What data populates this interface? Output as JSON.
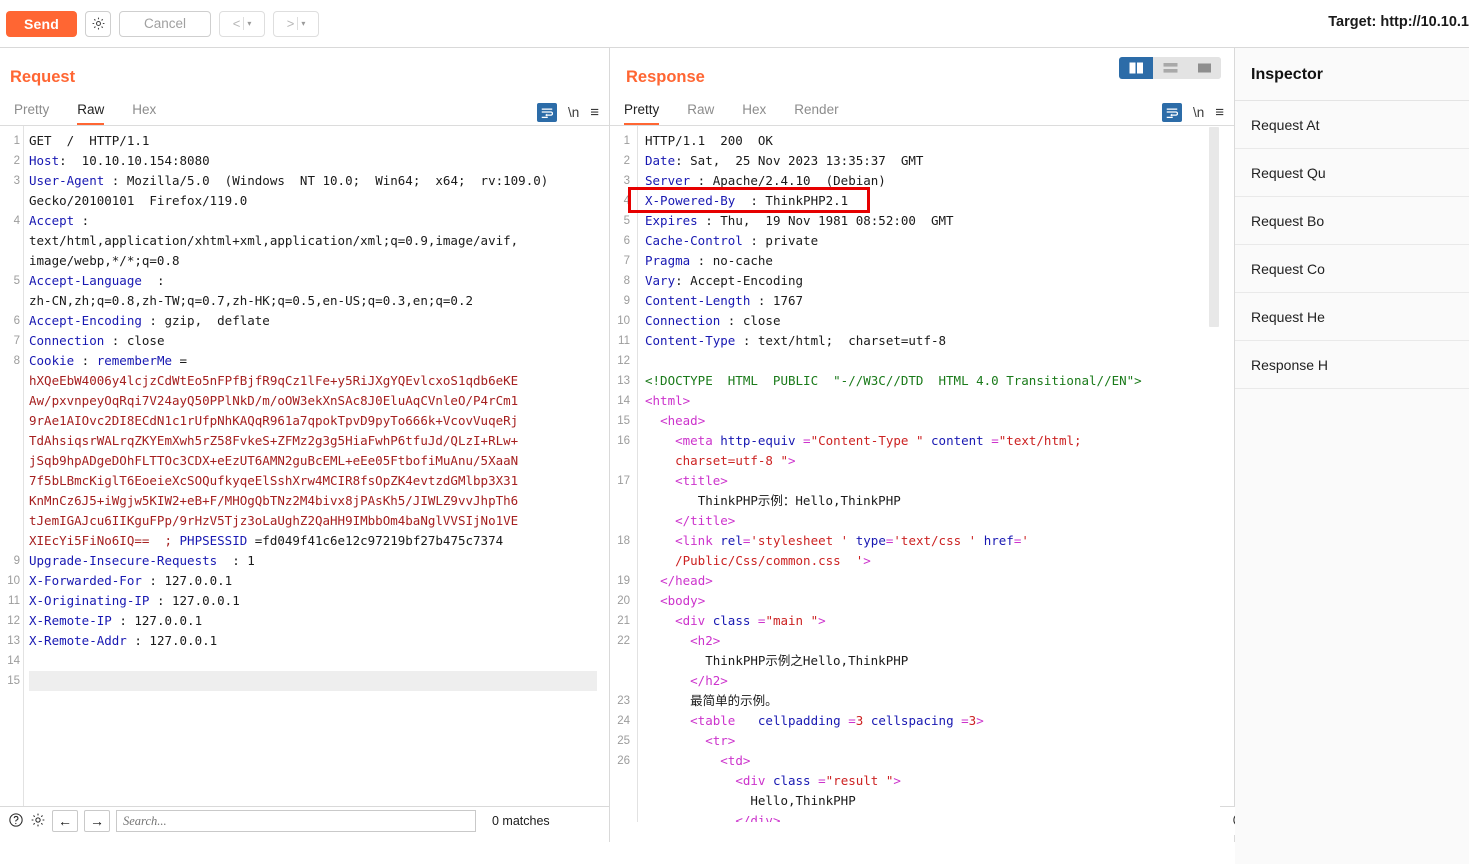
{
  "toolbar": {
    "send_label": "Send",
    "settings_icon": "gear-icon",
    "cancel_label": "Cancel",
    "back_label": "<",
    "forward_label": ">",
    "caret": "▾",
    "target_label": "Target: http://10.10.1"
  },
  "request": {
    "title": "Request",
    "tabs": [
      {
        "label": "Pretty",
        "active": false
      },
      {
        "label": "Raw",
        "active": true
      },
      {
        "label": "Hex",
        "active": false
      }
    ],
    "newline_label": "\\n",
    "lines": [
      {
        "n": "1",
        "parts": [
          {
            "t": "GET  /  HTTP/1.1",
            "c": "k-plain"
          }
        ]
      },
      {
        "n": "2",
        "parts": [
          {
            "t": "Host",
            "c": "k-blue"
          },
          {
            "t": ":  10.10.10.154:8080",
            "c": "k-plain"
          }
        ]
      },
      {
        "n": "3",
        "parts": [
          {
            "t": "User-Agent",
            "c": "k-blue"
          },
          {
            "t": " : Mozilla/5.0  (Windows  NT 10.0;  Win64;  x64;  rv:109.0)",
            "c": "k-plain"
          }
        ]
      },
      {
        "n": "",
        "parts": [
          {
            "t": "Gecko/20100101  Firefox/119.0",
            "c": "k-plain"
          }
        ]
      },
      {
        "n": "4",
        "parts": [
          {
            "t": "Accept",
            "c": "k-blue"
          },
          {
            "t": " :",
            "c": "k-plain"
          }
        ]
      },
      {
        "n": "",
        "parts": [
          {
            "t": "text/html,application/xhtml+xml,application/xml;q=0.9,image/avif,",
            "c": "k-plain"
          }
        ]
      },
      {
        "n": "",
        "parts": [
          {
            "t": "image/webp,*/*;q=0.8",
            "c": "k-plain"
          }
        ]
      },
      {
        "n": "5",
        "parts": [
          {
            "t": "Accept-Language",
            "c": "k-blue"
          },
          {
            "t": "  :",
            "c": "k-plain"
          }
        ]
      },
      {
        "n": "",
        "parts": [
          {
            "t": "zh-CN,zh;q=0.8,zh-TW;q=0.7,zh-HK;q=0.5,en-US;q=0.3,en;q=0.2",
            "c": "k-plain"
          }
        ]
      },
      {
        "n": "6",
        "parts": [
          {
            "t": "Accept-Encoding",
            "c": "k-blue"
          },
          {
            "t": " : gzip,  deflate",
            "c": "k-plain"
          }
        ]
      },
      {
        "n": "7",
        "parts": [
          {
            "t": "Connection",
            "c": "k-blue"
          },
          {
            "t": " : close",
            "c": "k-plain"
          }
        ]
      },
      {
        "n": "8",
        "parts": [
          {
            "t": "Cookie",
            "c": "k-blue"
          },
          {
            "t": " : ",
            "c": "k-plain"
          },
          {
            "t": "rememberMe",
            "c": "k-blue"
          },
          {
            "t": " =",
            "c": "k-plain"
          }
        ]
      },
      {
        "n": "",
        "parts": [
          {
            "t": "hXQeEbW4006y4lcjzCdWtEo5nFPfBjfR9qCz1lFe+y5RiJXgYQEvlcxoS1qdb6eKE",
            "c": "k-cookie"
          }
        ]
      },
      {
        "n": "",
        "parts": [
          {
            "t": "Aw/pxvnpeyOqRqi7V24ayQ50PPlNkD/m/oOW3ekXnSAc8J0EluAqCVnleO/P4rCm1",
            "c": "k-cookie"
          }
        ]
      },
      {
        "n": "",
        "parts": [
          {
            "t": "9rAe1AIOvc2DI8ECdN1c1rUfpNhKAQqR961a7qpokTpvD9pyTo666k+VcovVuqeRj",
            "c": "k-cookie"
          }
        ]
      },
      {
        "n": "",
        "parts": [
          {
            "t": "TdAhsiqsrWALrqZKYEmXwh5rZ58FvkeS+ZFMz2g3g5HiaFwhP6tfuJd/QLzI+RLw+",
            "c": "k-cookie"
          }
        ]
      },
      {
        "n": "",
        "parts": [
          {
            "t": "jSqb9hpADgeDOhFLTTOc3CDX+eEzUT6AMN2guBcEML+eEe05FtbofiMuAnu/5XaaN",
            "c": "k-cookie"
          }
        ]
      },
      {
        "n": "",
        "parts": [
          {
            "t": "7f5bLBmcKiglT6EoeieXcSOQufkyqeElSshXrw4MCIR8fsOpZK4evtzdGMlbp3X31",
            "c": "k-cookie"
          }
        ]
      },
      {
        "n": "",
        "parts": [
          {
            "t": "KnMnCz6J5+iWgjw5KIW2+eB+F/MHOgQbTNz2M4bivx8jPAsKh5/JIWLZ9vvJhpTh6",
            "c": "k-cookie"
          }
        ]
      },
      {
        "n": "",
        "parts": [
          {
            "t": "tJemIGAJcu6IIKguFPp/9rHzV5Tjz3oLaUghZ2QaHH9IMbbOm4baNglVVSIjNo1VE",
            "c": "k-cookie"
          }
        ]
      },
      {
        "n": "",
        "parts": [
          {
            "t": "XIEcYi5FiNo6IQ==  ; ",
            "c": "k-cookie"
          },
          {
            "t": "PHPSESSID",
            "c": "k-blue"
          },
          {
            "t": " =fd049f41c6e12c97219bf27b475c7374",
            "c": "k-plain"
          }
        ]
      },
      {
        "n": "9",
        "parts": [
          {
            "t": "Upgrade-Insecure-Requests",
            "c": "k-blue"
          },
          {
            "t": "  : 1",
            "c": "k-plain"
          }
        ]
      },
      {
        "n": "10",
        "parts": [
          {
            "t": "X-Forwarded-For",
            "c": "k-blue"
          },
          {
            "t": " : 127.0.0.1",
            "c": "k-plain"
          }
        ]
      },
      {
        "n": "11",
        "parts": [
          {
            "t": "X-Originating-IP",
            "c": "k-blue"
          },
          {
            "t": " : 127.0.0.1",
            "c": "k-plain"
          }
        ]
      },
      {
        "n": "12",
        "parts": [
          {
            "t": "X-Remote-IP",
            "c": "k-blue"
          },
          {
            "t": " : 127.0.0.1",
            "c": "k-plain"
          }
        ]
      },
      {
        "n": "13",
        "parts": [
          {
            "t": "X-Remote-Addr",
            "c": "k-blue"
          },
          {
            "t": " : 127.0.0.1",
            "c": "k-plain"
          }
        ]
      },
      {
        "n": "14",
        "parts": [
          {
            "t": "",
            "c": "k-plain"
          }
        ]
      },
      {
        "n": "15",
        "parts": [
          {
            "t": "",
            "c": "k-plain"
          }
        ],
        "highlight": true
      }
    ]
  },
  "response": {
    "title": "Response",
    "tabs": [
      {
        "label": "Pretty",
        "active": true
      },
      {
        "label": "Raw",
        "active": false
      },
      {
        "label": "Hex",
        "active": false
      },
      {
        "label": "Render",
        "active": false
      }
    ],
    "newline_label": "\\n",
    "layout_buttons": [
      {
        "name": "split-vertical",
        "active": true
      },
      {
        "name": "split-horizontal",
        "active": false
      },
      {
        "name": "single-pane",
        "active": false
      }
    ],
    "highlight_box": {
      "line": 4,
      "color": "#e60000"
    },
    "lines": [
      {
        "n": "1",
        "parts": [
          {
            "t": "HTTP/1.1  200  OK",
            "c": "k-plain"
          }
        ]
      },
      {
        "n": "2",
        "parts": [
          {
            "t": "Date",
            "c": "k-blue"
          },
          {
            "t": ": Sat,  25 Nov 2023 13:35:37  GMT",
            "c": "k-plain"
          }
        ]
      },
      {
        "n": "3",
        "parts": [
          {
            "t": "Server",
            "c": "k-blue"
          },
          {
            "t": " : Apache/2.4.10  (Debian)",
            "c": "k-plain"
          }
        ]
      },
      {
        "n": "4",
        "parts": [
          {
            "t": "X-Powered-By",
            "c": "k-blue"
          },
          {
            "t": "  : ThinkPHP2.1",
            "c": "k-plain"
          }
        ]
      },
      {
        "n": "5",
        "parts": [
          {
            "t": "Expires",
            "c": "k-blue"
          },
          {
            "t": " : Thu,  19 Nov 1981 08:52:00  GMT",
            "c": "k-plain"
          }
        ]
      },
      {
        "n": "6",
        "parts": [
          {
            "t": "Cache-Control",
            "c": "k-blue"
          },
          {
            "t": " : private",
            "c": "k-plain"
          }
        ]
      },
      {
        "n": "7",
        "parts": [
          {
            "t": "Pragma",
            "c": "k-blue"
          },
          {
            "t": " : no-cache",
            "c": "k-plain"
          }
        ]
      },
      {
        "n": "8",
        "parts": [
          {
            "t": "Vary",
            "c": "k-blue"
          },
          {
            "t": ": Accept-Encoding",
            "c": "k-plain"
          }
        ]
      },
      {
        "n": "9",
        "parts": [
          {
            "t": "Content-Length",
            "c": "k-blue"
          },
          {
            "t": " : 1767",
            "c": "k-plain"
          }
        ]
      },
      {
        "n": "10",
        "parts": [
          {
            "t": "Connection",
            "c": "k-blue"
          },
          {
            "t": " : close",
            "c": "k-plain"
          }
        ]
      },
      {
        "n": "11",
        "parts": [
          {
            "t": "Content-Type",
            "c": "k-blue"
          },
          {
            "t": " : text/html;  charset=utf-8",
            "c": "k-plain"
          }
        ]
      },
      {
        "n": "12",
        "parts": [
          {
            "t": "",
            "c": "k-plain"
          }
        ]
      },
      {
        "n": "13",
        "parts": [
          {
            "t": "<!DOCTYPE  HTML  PUBLIC  \"-//W3C//DTD  HTML 4.0 Transitional//EN\">",
            "c": "k-doctype"
          }
        ]
      },
      {
        "n": "14",
        "parts": [
          {
            "t": "<html",
            "c": "k-tag"
          },
          {
            "t": ">",
            "c": "k-tag"
          }
        ]
      },
      {
        "n": "15",
        "parts": [
          {
            "t": "  <head>",
            "c": "k-tag"
          }
        ]
      },
      {
        "n": "16",
        "parts": [
          {
            "t": "    <meta ",
            "c": "k-tag"
          },
          {
            "t": "http-equiv",
            "c": "k-attr"
          },
          {
            "t": " =",
            "c": "k-tag"
          },
          {
            "t": "\"Content-Type \"",
            "c": "k-val"
          },
          {
            "t": " ",
            "c": "k-tag"
          },
          {
            "t": "content",
            "c": "k-attr"
          },
          {
            "t": " =",
            "c": "k-tag"
          },
          {
            "t": "\"text/html;",
            "c": "k-val"
          }
        ]
      },
      {
        "n": "",
        "parts": [
          {
            "t": "    ",
            "c": "k-tag"
          },
          {
            "t": "charset=utf-8 \"",
            "c": "k-val"
          },
          {
            "t": ">",
            "c": "k-tag"
          }
        ]
      },
      {
        "n": "17",
        "parts": [
          {
            "t": "    <title>",
            "c": "k-tag"
          }
        ]
      },
      {
        "n": "",
        "parts": [
          {
            "t": "       ThinkPHP示例：Hello,ThinkPHP",
            "c": "k-txt"
          }
        ]
      },
      {
        "n": "",
        "parts": [
          {
            "t": "    </title>",
            "c": "k-tag"
          }
        ]
      },
      {
        "n": "18",
        "parts": [
          {
            "t": "    <link ",
            "c": "k-tag"
          },
          {
            "t": "rel",
            "c": "k-attr"
          },
          {
            "t": "=",
            "c": "k-tag"
          },
          {
            "t": "'stylesheet '",
            "c": "k-val"
          },
          {
            "t": " ",
            "c": "k-tag"
          },
          {
            "t": "type",
            "c": "k-attr"
          },
          {
            "t": "=",
            "c": "k-tag"
          },
          {
            "t": "'text/css '",
            "c": "k-val"
          },
          {
            "t": " ",
            "c": "k-tag"
          },
          {
            "t": "href",
            "c": "k-attr"
          },
          {
            "t": "=",
            "c": "k-tag"
          },
          {
            "t": "'",
            "c": "k-val"
          }
        ]
      },
      {
        "n": "",
        "parts": [
          {
            "t": "    ",
            "c": "k-tag"
          },
          {
            "t": "/Public/Css/common.css  '",
            "c": "k-val"
          },
          {
            "t": ">",
            "c": "k-tag"
          }
        ]
      },
      {
        "n": "19",
        "parts": [
          {
            "t": "  </head>",
            "c": "k-tag"
          }
        ]
      },
      {
        "n": "20",
        "parts": [
          {
            "t": "  <body>",
            "c": "k-tag"
          }
        ]
      },
      {
        "n": "21",
        "parts": [
          {
            "t": "    <div ",
            "c": "k-tag"
          },
          {
            "t": "class",
            "c": "k-attr"
          },
          {
            "t": " =",
            "c": "k-tag"
          },
          {
            "t": "\"main \"",
            "c": "k-val"
          },
          {
            "t": ">",
            "c": "k-tag"
          }
        ]
      },
      {
        "n": "22",
        "parts": [
          {
            "t": "      <h2>",
            "c": "k-tag"
          }
        ]
      },
      {
        "n": "",
        "parts": [
          {
            "t": "        ThinkPHP示例之Hello,ThinkPHP",
            "c": "k-txt"
          }
        ]
      },
      {
        "n": "",
        "parts": [
          {
            "t": "      </h2>",
            "c": "k-tag"
          }
        ]
      },
      {
        "n": "23",
        "parts": [
          {
            "t": "      最简单的示例。",
            "c": "k-txt"
          }
        ]
      },
      {
        "n": "24",
        "parts": [
          {
            "t": "      <table ",
            "c": "k-tag"
          },
          {
            "t": "  cellpadding",
            "c": "k-attr"
          },
          {
            "t": " =",
            "c": "k-tag"
          },
          {
            "t": "3",
            "c": "k-val"
          },
          {
            "t": " ",
            "c": "k-tag"
          },
          {
            "t": "cellspacing",
            "c": "k-attr"
          },
          {
            "t": " =",
            "c": "k-tag"
          },
          {
            "t": "3",
            "c": "k-val"
          },
          {
            "t": ">",
            "c": "k-tag"
          }
        ]
      },
      {
        "n": "25",
        "parts": [
          {
            "t": "        <tr>",
            "c": "k-tag"
          }
        ]
      },
      {
        "n": "26",
        "parts": [
          {
            "t": "          <td>",
            "c": "k-tag"
          }
        ]
      },
      {
        "n": "",
        "parts": [
          {
            "t": "            <div ",
            "c": "k-tag"
          },
          {
            "t": "class",
            "c": "k-attr"
          },
          {
            "t": " =",
            "c": "k-tag"
          },
          {
            "t": "\"result \"",
            "c": "k-val"
          },
          {
            "t": ">",
            "c": "k-tag"
          }
        ]
      },
      {
        "n": "",
        "parts": [
          {
            "t": "              Hello,ThinkPHP",
            "c": "k-txt"
          }
        ]
      },
      {
        "n": "",
        "parts": [
          {
            "t": "            </div>",
            "c": "k-tag"
          }
        ]
      }
    ]
  },
  "inspector": {
    "title": "Inspector",
    "items": [
      {
        "label": "Request At"
      },
      {
        "label": "Request Qu"
      },
      {
        "label": "Request Bo"
      },
      {
        "label": "Request Co"
      },
      {
        "label": "Request He"
      },
      {
        "label": "Response H"
      }
    ]
  },
  "bottombar": {
    "help_icon": "help-icon",
    "settings_icon": "gear-icon",
    "prev_label": "←",
    "next_label": "→",
    "search_placeholder": "Search...",
    "matches_label": "0 matches"
  }
}
